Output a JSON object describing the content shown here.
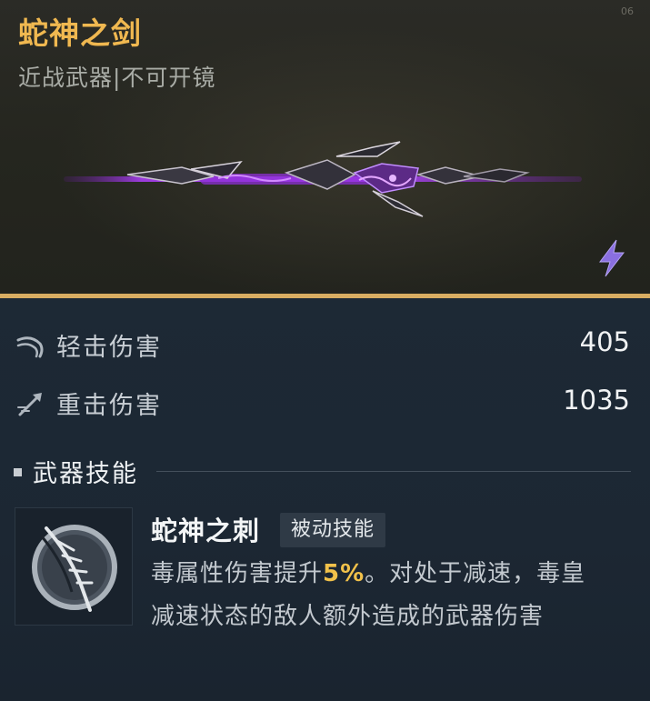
{
  "weapon": {
    "name": "蛇神之剑",
    "subtitle": "近战武器|不可开镜",
    "corner_mark": "06"
  },
  "stats": [
    {
      "icon": "light-attack-icon",
      "label": "轻击伤害",
      "value": "405"
    },
    {
      "icon": "heavy-attack-icon",
      "label": "重击伤害",
      "value": "1035"
    }
  ],
  "section": {
    "title": "武器技能"
  },
  "skill": {
    "name": "蛇神之刺",
    "tag": "被动技能",
    "desc_before": "毒属性伤害提升",
    "desc_highlight": "5%",
    "desc_after": "。对处于减速，毒皇减速状态的敌人额外造成的武器伤害"
  },
  "colors": {
    "accent_gold": "#d9ad62",
    "title_gold": "#f0b850",
    "highlight_yellow": "#f2c14a",
    "weapon_purple": "#a23ee8",
    "lightning_purple": "#8a6fe0",
    "panel_bg": "#1e2a36"
  }
}
